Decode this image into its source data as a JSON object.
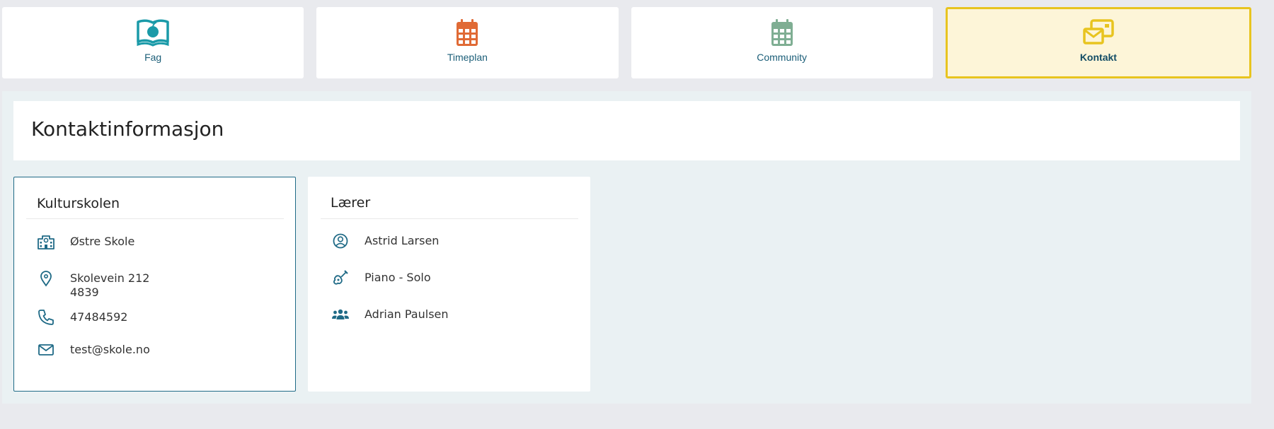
{
  "tabs": [
    {
      "label": "Fag",
      "icon": "book-apple-icon",
      "color": "#1a9aa8",
      "active": false
    },
    {
      "label": "Timeplan",
      "icon": "calendar-icon",
      "color": "#e06a35",
      "active": false
    },
    {
      "label": "Community",
      "icon": "calendar-grid-icon",
      "color": "#7fae93",
      "active": false
    },
    {
      "label": "Kontakt",
      "icon": "mail-stack-icon",
      "color": "#e8c41f",
      "active": true
    }
  ],
  "page": {
    "title": "Kontaktinformasjon"
  },
  "school_card": {
    "title": "Kulturskolen",
    "school_name": "Østre Skole",
    "address_line1": "Skolevein 212",
    "address_line2": "4839",
    "phone": "47484592",
    "email": "test@skole.no"
  },
  "teacher_card": {
    "title": "Lærer",
    "teacher_name": "Astrid Larsen",
    "subject": "Piano - Solo",
    "student": "Adrian Paulsen"
  },
  "colors": {
    "accent": "#1f6a86",
    "active_tab_bg": "#fdf5d8",
    "active_tab_border": "#e8c41f",
    "page_bg": "#e9eaee",
    "panel_bg": "#eaf1f3"
  }
}
